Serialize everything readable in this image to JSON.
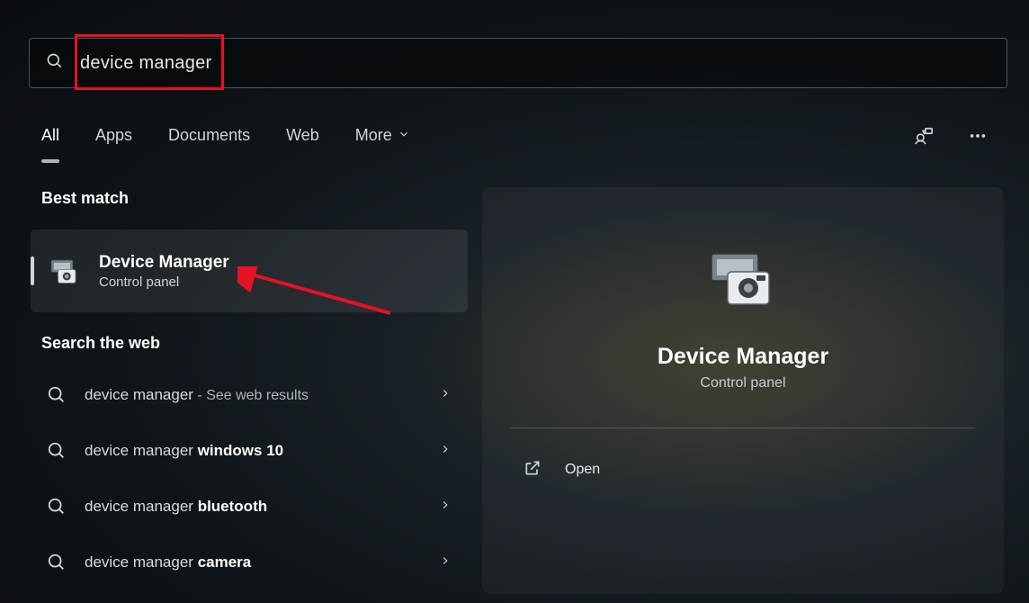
{
  "search": {
    "value": "device manager"
  },
  "tabs": {
    "all": "All",
    "apps": "Apps",
    "documents": "Documents",
    "web": "Web",
    "more": "More"
  },
  "left": {
    "best_match_header": "Best match",
    "best_match": {
      "title": "Device Manager",
      "subtitle": "Control panel"
    },
    "web_header": "Search the web",
    "web_results": [
      {
        "prefix": "device manager",
        "bold": "",
        "after": " - See web results"
      },
      {
        "prefix": "device manager ",
        "bold": "windows 10",
        "after": ""
      },
      {
        "prefix": "device manager ",
        "bold": "bluetooth",
        "after": ""
      },
      {
        "prefix": "device manager ",
        "bold": "camera",
        "after": ""
      }
    ]
  },
  "right": {
    "title": "Device Manager",
    "subtitle": "Control panel",
    "open": "Open"
  }
}
